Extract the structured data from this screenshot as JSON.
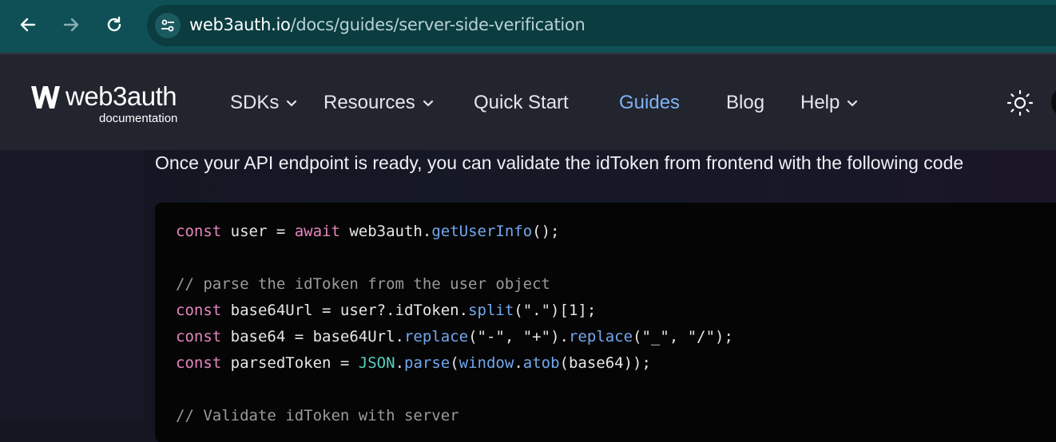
{
  "browser": {
    "url_host": "web3auth.io",
    "url_path": "/docs/guides/server-side-verification"
  },
  "site": {
    "logo_text": "web3auth",
    "logo_subtext": "documentation",
    "nav": [
      {
        "label": "SDKs",
        "dropdown": true
      },
      {
        "label": "Resources",
        "dropdown": true
      },
      {
        "label": "Quick Start",
        "dropdown": false
      },
      {
        "label": "Guides",
        "dropdown": false,
        "active": true
      },
      {
        "label": "Blog",
        "dropdown": false
      },
      {
        "label": "Help",
        "dropdown": true
      }
    ],
    "active_color": "#7fb2f4"
  },
  "content": {
    "intro": "Once your API endpoint is ready, you can validate the idToken from frontend with the following code",
    "code_lines": [
      "const user = await web3auth.getUserInfo();",
      "",
      "// parse the idToken from the user object",
      "const base64Url = user?.idToken.split(\".\")[1];",
      "const base64 = base64Url.replace(\"-\", \"+\").replace(\"_\", \"/\");",
      "const parsedToken = JSON.parse(window.atob(base64));",
      "",
      "// Validate idToken with server"
    ]
  }
}
